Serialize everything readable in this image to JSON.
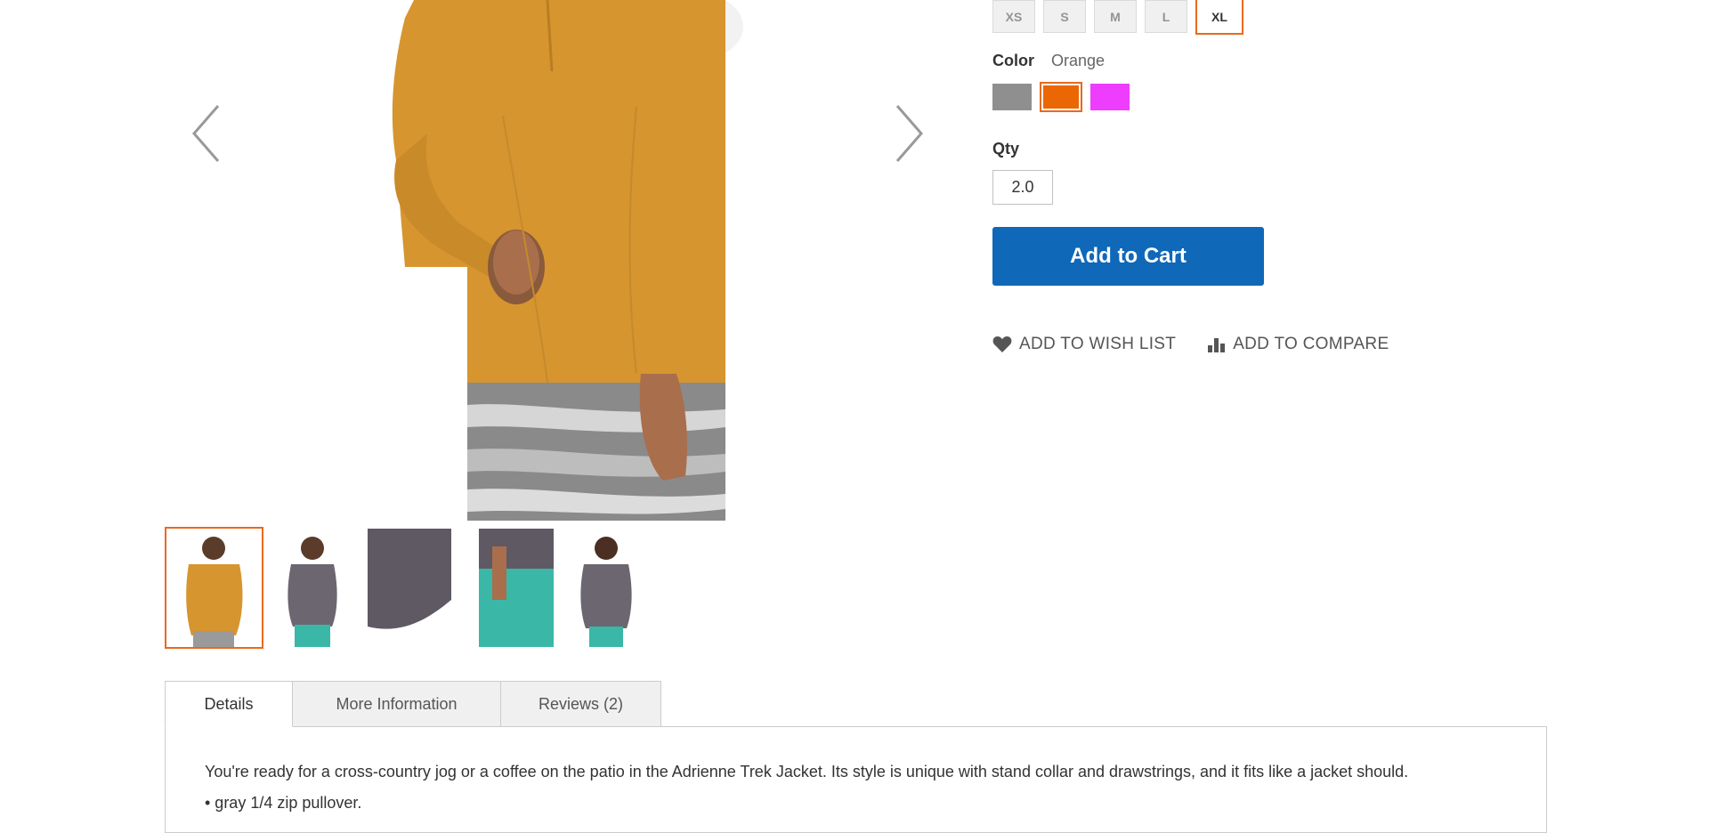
{
  "product_gallery": {
    "prev_label": "Previous",
    "next_label": "Next",
    "thumbnails": [
      "orange front",
      "gray front",
      "gray detail",
      "gray side",
      "gray back"
    ]
  },
  "options": {
    "sizes": [
      "XS",
      "S",
      "M",
      "L",
      "XL"
    ],
    "selected_size": "XL",
    "color_label": "Color",
    "color_value": "Orange",
    "colors": [
      {
        "name": "Gray",
        "hex": "#8f8f8f"
      },
      {
        "name": "Orange",
        "hex": "#eb6703"
      },
      {
        "name": "Purple",
        "hex": "#ef3dff"
      }
    ],
    "qty_label": "Qty",
    "qty_value": "2.0",
    "add_to_cart": "Add to Cart",
    "wish_list": "ADD TO WISH LIST",
    "compare": "ADD TO COMPARE"
  },
  "tabs": {
    "items": [
      "Details",
      "More Information",
      "Reviews (2)"
    ],
    "active": "Details",
    "details_text": "You're ready for a cross-country jog or a coffee on the patio in the Adrienne Trek Jacket. Its style is unique with stand collar and drawstrings, and it fits like a jacket should.",
    "details_bullet": "• gray 1/4 zip pullover."
  },
  "colors": {
    "accent": "#e86a1e",
    "button": "#1068b8",
    "shirt_orange": "#d6952f",
    "shirt_gray": "#6b6670",
    "teal": "#3bb7a8"
  }
}
